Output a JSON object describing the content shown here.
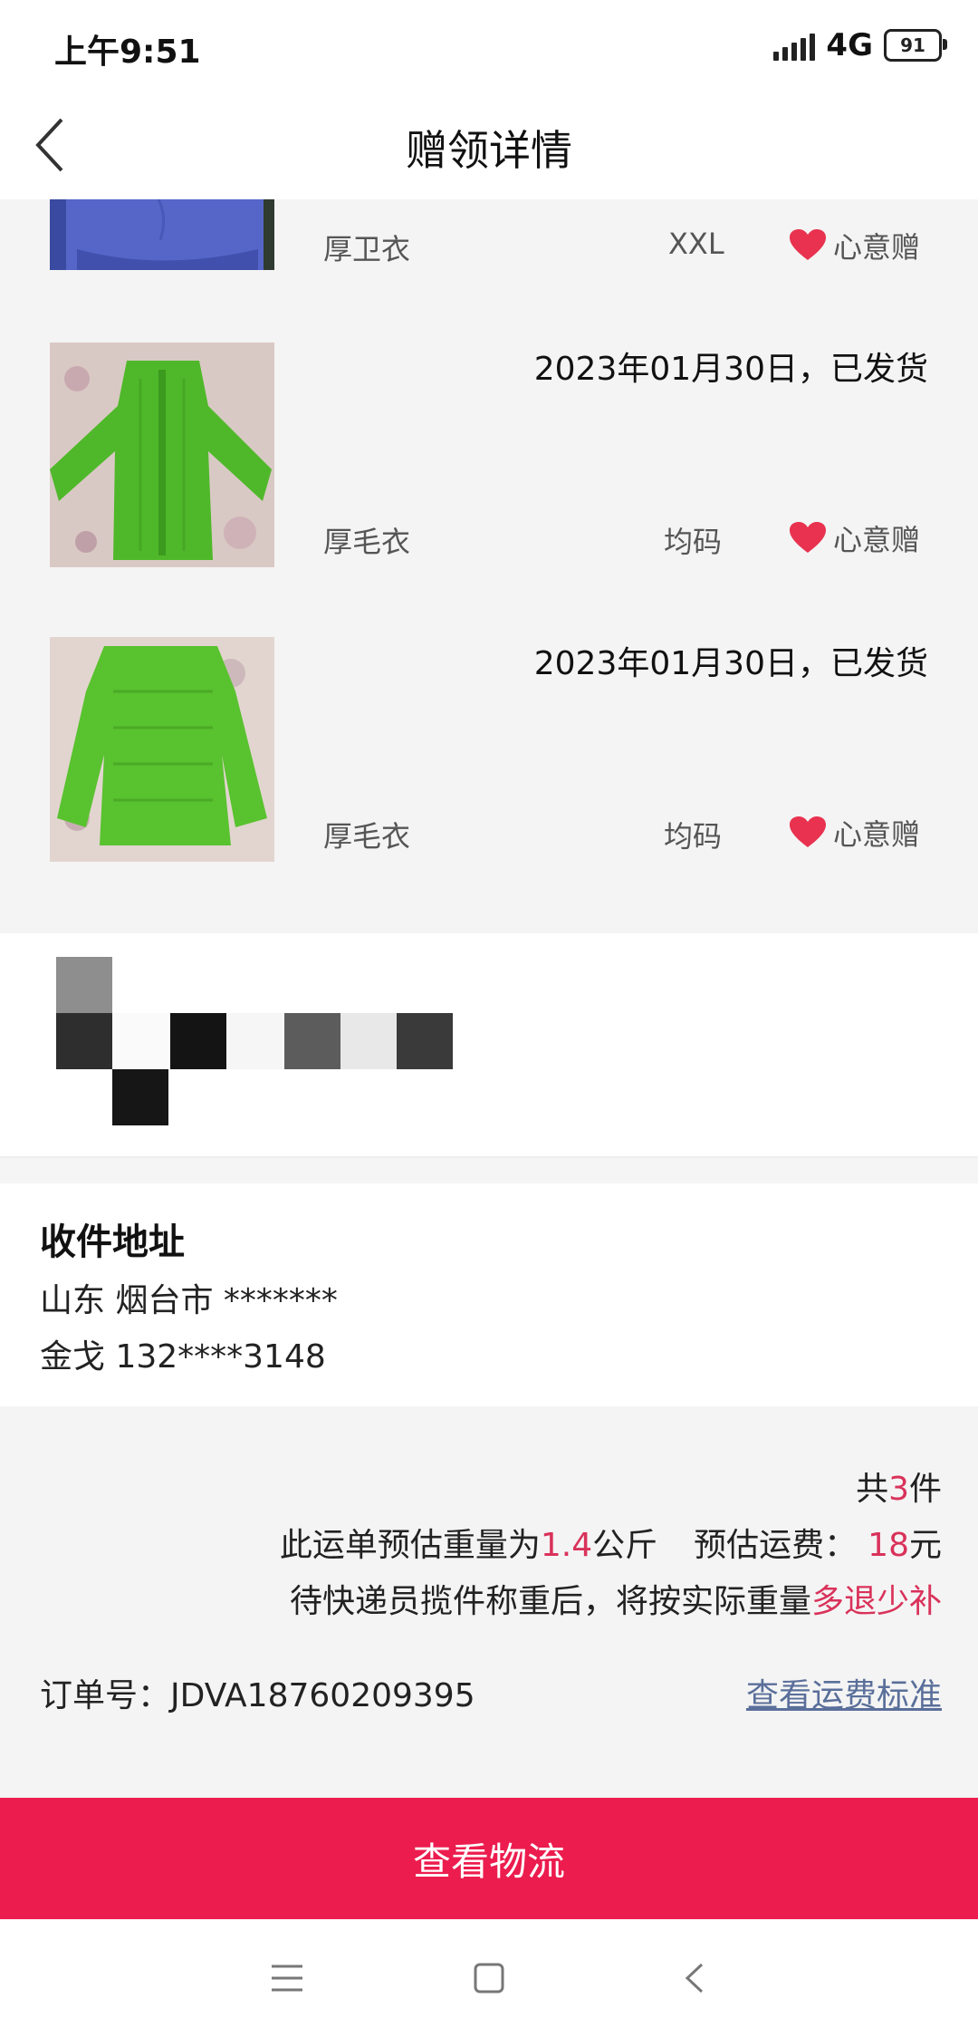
{
  "status_bar": {
    "time": "上午9:51",
    "network": "4G",
    "battery": "91"
  },
  "nav": {
    "title": "赠领详情",
    "back_icon": "chevron-left-icon"
  },
  "items": [
    {
      "date": "",
      "name": "厚卫衣",
      "size": "XXL",
      "tag": "心意赠",
      "image": "blue-hoodie-photo"
    },
    {
      "date": "2023年01月30日，已发货",
      "name": "厚毛衣",
      "size": "均码",
      "tag": "心意赠",
      "image": "green-sweater-photo"
    },
    {
      "date": "2023年01月30日，已发货",
      "name": "厚毛衣",
      "size": "均码",
      "tag": "心意赠",
      "image": "green-sweater-photo"
    }
  ],
  "address": {
    "title": "收件地址",
    "line1": "山东 烟台市 *******",
    "line2": "金戈 132****3148"
  },
  "summary": {
    "count_prefix": "共",
    "count": "3",
    "count_suffix": "件",
    "weight_prefix": "此运单预估重量为",
    "weight": "1.4",
    "weight_unit": "公斤",
    "fee_prefix": "预估运费：",
    "fee": "18",
    "fee_unit": "元",
    "note_prefix": "待快递员揽件称重后，将按实际重量",
    "note_highlight": "多退少补",
    "order_label": "订单号：",
    "order_no": "JDVA18760209395",
    "fee_link": "查看运费标准"
  },
  "cta": {
    "label": "查看物流"
  },
  "colors": {
    "accent": "#d9325a",
    "cta_bg": "#ec1c4e",
    "heart": "#e8324f",
    "link": "#5a6f9a"
  },
  "system_nav": {
    "menu": "menu-icon",
    "home": "home-icon",
    "back": "back-icon"
  }
}
